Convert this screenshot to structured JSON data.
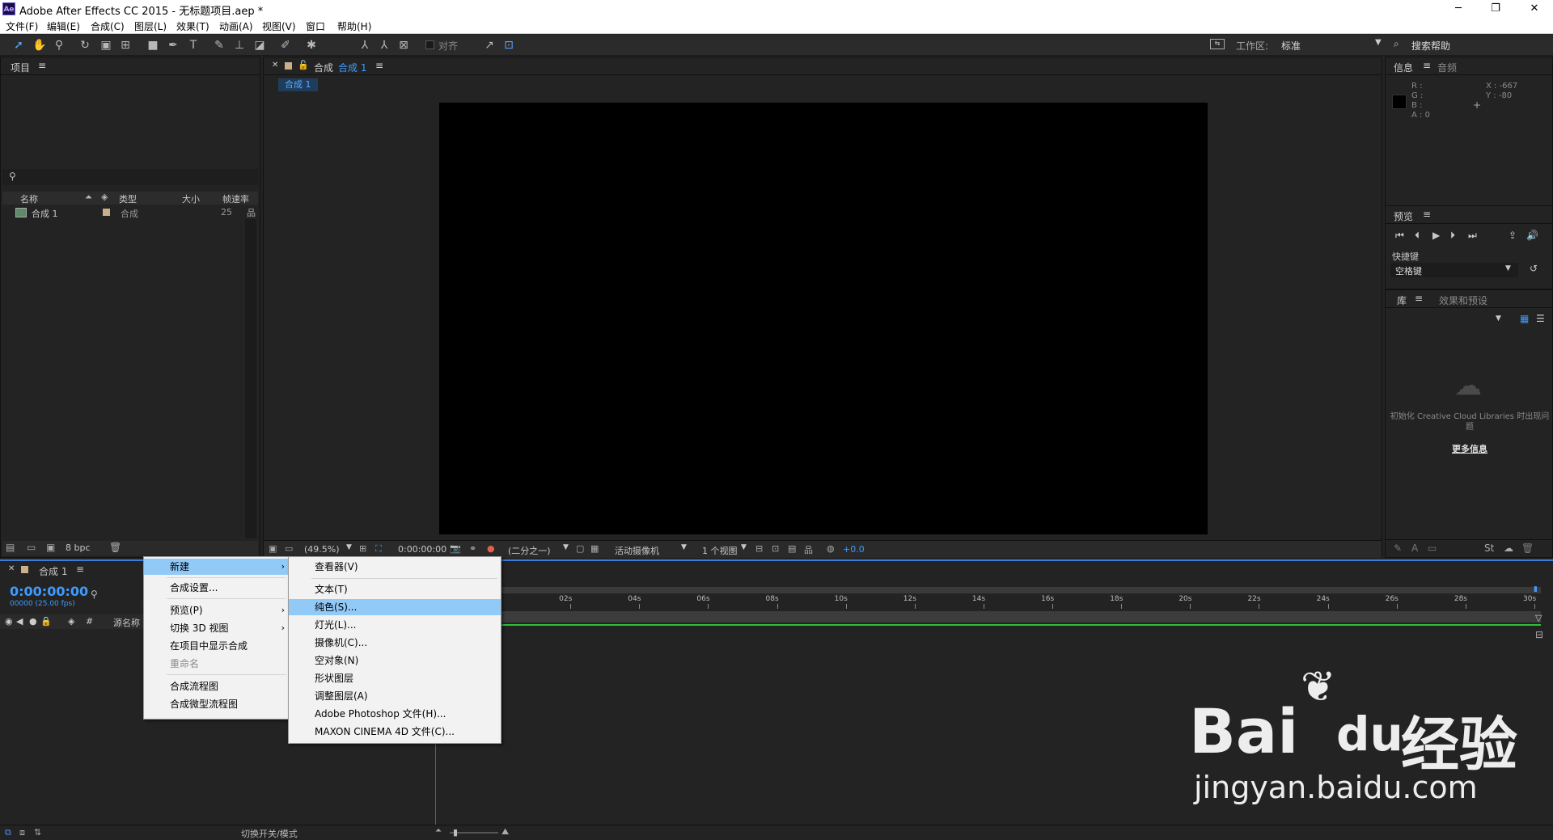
{
  "window": {
    "title": "Adobe After Effects CC 2015 - 无标题项目.aep *",
    "logo_text": "Ae",
    "minimize": "─",
    "maximize": "❐",
    "close": "✕"
  },
  "menubar": [
    "文件(F)",
    "编辑(E)",
    "合成(C)",
    "图层(L)",
    "效果(T)",
    "动画(A)",
    "视图(V)",
    "窗口",
    "帮助(H)"
  ],
  "toolbar": {
    "align_label": "对齐",
    "workspace_label": "工作区:",
    "workspace_value": "标准",
    "search_help": "搜索帮助"
  },
  "project": {
    "title": "项目",
    "columns": [
      "名称",
      "类型",
      "大小",
      "帧速率"
    ],
    "items": [
      {
        "name": "合成 1",
        "type": "合成",
        "size": "",
        "fps": "25"
      }
    ],
    "bpc": "8 bpc"
  },
  "viewer": {
    "tab_label": "合成",
    "comp_name": "合成 1",
    "sub_tab": "合成 1",
    "zoom": "(49.5%)",
    "timecode": "0:00:00:00",
    "resolution": "(二分之一)",
    "camera": "活动摄像机",
    "views": "1 个视图",
    "exposure": "+0.0"
  },
  "info": {
    "tab_info": "信息",
    "tab_audio": "音频",
    "r": "R :",
    "g": "G :",
    "b": "B :",
    "a": "A : 0",
    "x": "X : -667",
    "y": "Y : -80"
  },
  "preview": {
    "title": "预览",
    "shortcut_label": "快捷键",
    "shortcut_value": "空格键"
  },
  "library": {
    "tab_lib": "库",
    "tab_effects": "效果和预设",
    "message": "初始化 Creative Cloud Libraries 时出现问题",
    "more_info": "更多信息"
  },
  "timeline": {
    "comp_name": "合成 1",
    "timecode": "0:00:00:00",
    "fps": "00000 (25.00 fps)",
    "source_name": "源名称",
    "toggle_modes": "切换开关/模式",
    "ticks": [
      "02s",
      "04s",
      "06s",
      "08s",
      "10s",
      "12s",
      "14s",
      "16s",
      "18s",
      "20s",
      "22s",
      "24s",
      "26s",
      "28s",
      "30s"
    ]
  },
  "context_menu": {
    "items": [
      {
        "label": "新建",
        "submenu": true,
        "highlight": true
      },
      {
        "label": "合成设置...",
        "sep_before": true
      },
      {
        "label": "预览(P)",
        "submenu": true,
        "sep_before": true
      },
      {
        "label": "切换 3D 视图",
        "submenu": true
      },
      {
        "label": "在项目中显示合成"
      },
      {
        "label": "重命名",
        "disabled": true
      },
      {
        "label": "合成流程图",
        "sep_before": true
      },
      {
        "label": "合成微型流程图"
      }
    ]
  },
  "submenu": {
    "items": [
      {
        "label": "查看器(V)"
      },
      {
        "label": "文本(T)",
        "sep_before": true
      },
      {
        "label": "纯色(S)...",
        "highlight": true
      },
      {
        "label": "灯光(L)..."
      },
      {
        "label": "摄像机(C)..."
      },
      {
        "label": "空对象(N)"
      },
      {
        "label": "形状图层"
      },
      {
        "label": "调整图层(A)"
      },
      {
        "label": "Adobe Photoshop 文件(H)..."
      },
      {
        "label": "MAXON CINEMA 4D 文件(C)..."
      }
    ]
  },
  "watermark": {
    "brand": "Bai",
    "brand2": "du",
    "cn": "经验",
    "url": "jingyan.baidu.com"
  },
  "colors": {
    "accent": "#3e9bff",
    "highlight": "#91c9f7",
    "bg": "#232323"
  }
}
